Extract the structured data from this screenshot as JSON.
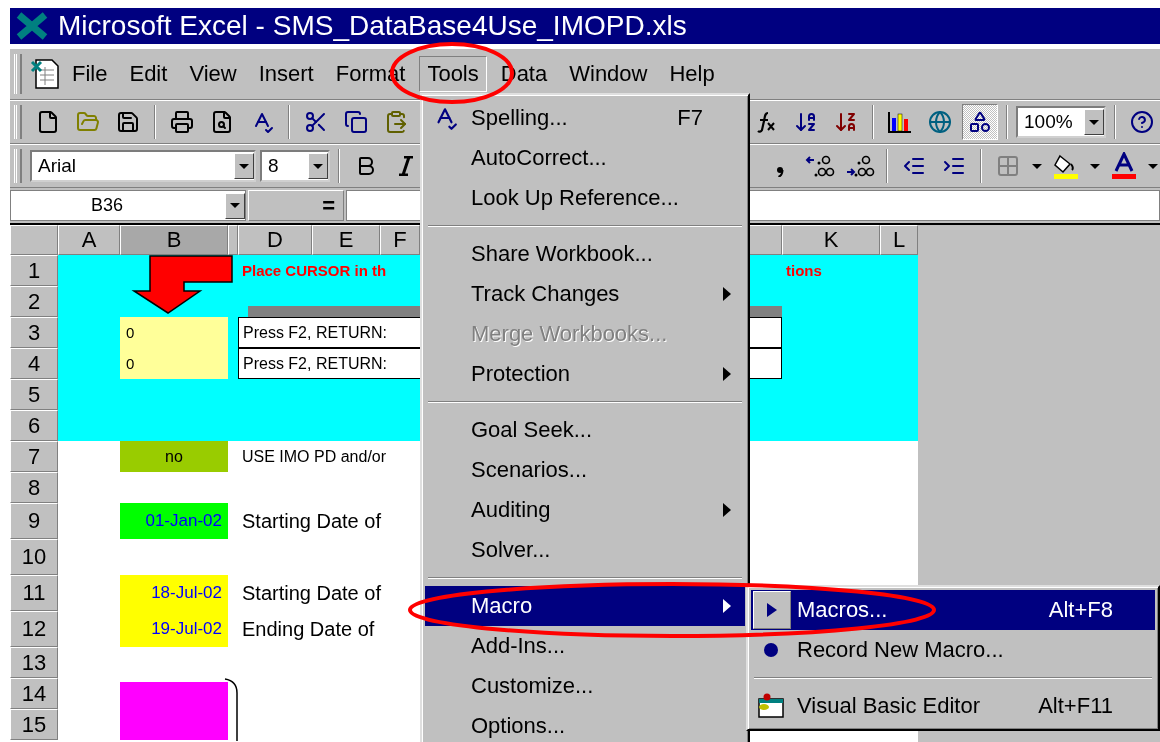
{
  "window": {
    "title": "Microsoft Excel - SMS_DataBase4Use_IMOPD.xls"
  },
  "menu_bar": [
    {
      "label": "File",
      "selected": false
    },
    {
      "label": "Edit",
      "selected": false
    },
    {
      "label": "View",
      "selected": false
    },
    {
      "label": "Insert",
      "selected": false
    },
    {
      "label": "Format",
      "selected": false
    },
    {
      "label": "Tools",
      "selected": true
    },
    {
      "label": "Data",
      "selected": false
    },
    {
      "label": "Window",
      "selected": false
    },
    {
      "label": "Help",
      "selected": false
    }
  ],
  "standard_toolbar": {
    "left": [
      {
        "kind": "new",
        "pressed": false
      },
      {
        "kind": "open",
        "pressed": false
      },
      {
        "kind": "save",
        "pressed": false
      },
      {
        "kind": "separator"
      },
      {
        "kind": "print",
        "pressed": false
      },
      {
        "kind": "preview",
        "pressed": false
      },
      {
        "kind": "spelling",
        "pressed": false
      },
      {
        "kind": "separator"
      },
      {
        "kind": "cut",
        "pressed": false
      },
      {
        "kind": "copy",
        "pressed": false
      },
      {
        "kind": "paste",
        "pressed": false
      }
    ],
    "right": [
      {
        "kind": "function",
        "pressed": false
      },
      {
        "kind": "sort-ascending",
        "pressed": false
      },
      {
        "kind": "sort-descending",
        "pressed": false
      },
      {
        "kind": "separator"
      },
      {
        "kind": "chart",
        "pressed": false
      },
      {
        "kind": "map",
        "pressed": false
      },
      {
        "kind": "drawing",
        "pressed": true
      },
      {
        "kind": "separator"
      },
      {
        "kind": "combo",
        "value": "100%"
      },
      {
        "kind": "separator"
      },
      {
        "kind": "help",
        "pressed": false
      }
    ]
  },
  "formatting_toolbar": {
    "left": [
      {
        "kind": "font",
        "value": "Arial"
      },
      {
        "kind": "size",
        "value": "8"
      },
      {
        "kind": "separator"
      },
      {
        "kind": "bold",
        "pressed": false
      },
      {
        "kind": "italic",
        "pressed": false
      }
    ],
    "right": [
      {
        "kind": "comma",
        "pressed": false
      },
      {
        "kind": "increase-decimal",
        "pressed": false
      },
      {
        "kind": "decrease-decimal",
        "pressed": false
      },
      {
        "kind": "separator"
      },
      {
        "kind": "outdent",
        "pressed": false
      },
      {
        "kind": "indent",
        "pressed": false
      },
      {
        "kind": "separator"
      },
      {
        "kind": "borders",
        "pressed": false
      },
      {
        "kind": "dropdown"
      },
      {
        "kind": "fill-color",
        "pressed": false
      },
      {
        "kind": "dropdown"
      },
      {
        "kind": "font-color",
        "pressed": false
      },
      {
        "kind": "dropdown"
      }
    ]
  },
  "formula_bar": {
    "name_box": "B36",
    "equals": "="
  },
  "columns": [
    {
      "label": "A",
      "selected": false
    },
    {
      "label": "B",
      "selected": true
    },
    {
      "selected": false
    },
    {
      "label": "D",
      "selected": false
    },
    {
      "label": "E",
      "selected": false
    },
    {
      "label": "F",
      "selected": false
    },
    {
      "label": "K",
      "selected": false
    },
    {
      "label": "L",
      "selected": false
    }
  ],
  "rows": [
    {
      "number": "1",
      "kind": "banner",
      "tall": false,
      "b": {
        "kind": "arrow"
      },
      "d": {
        "kind": "alert",
        "text": "Place CURSOR in th"
      },
      "k": {
        "kind": "alert",
        "text": "tions"
      }
    },
    {
      "number": "2",
      "kind": "banner",
      "tall": false,
      "d": {
        "kind": "bar"
      }
    },
    {
      "number": "3",
      "kind": "banner",
      "tall": false,
      "b": {
        "kind": "number",
        "text": "0",
        "color": "#ffff99"
      },
      "d": {
        "kind": "note",
        "text": "Press F2, RETURN:"
      }
    },
    {
      "number": "4",
      "kind": "banner",
      "tall": false,
      "b": {
        "kind": "number",
        "text": "0",
        "color": "#ffff99"
      },
      "d": {
        "kind": "note",
        "text": "Press F2, RETURN:"
      }
    },
    {
      "number": "5",
      "kind": "banner",
      "tall": false
    },
    {
      "number": "6",
      "kind": "banner",
      "tall": false
    },
    {
      "number": "7",
      "kind": "plain",
      "tall": false,
      "b": {
        "kind": "flag",
        "text": "no",
        "color": "#99cc00"
      },
      "d": {
        "kind": "label",
        "text": "USE IMO PD and/or"
      }
    },
    {
      "number": "8",
      "kind": "plain",
      "tall": false
    },
    {
      "number": "9",
      "kind": "plain",
      "tall": true,
      "b": {
        "kind": "date",
        "text": "01-Jan-02",
        "color": "#00ff00"
      },
      "d": {
        "kind": "heading",
        "text": "Starting Date of"
      }
    },
    {
      "number": "10",
      "kind": "plain",
      "tall": true
    },
    {
      "number": "11",
      "kind": "plain",
      "tall": true,
      "b": {
        "kind": "date",
        "text": "18-Jul-02",
        "color": "#ffff00"
      },
      "d": {
        "kind": "heading",
        "text": "Starting Date of"
      }
    },
    {
      "number": "12",
      "kind": "plain",
      "tall": true,
      "b": {
        "kind": "date",
        "text": "19-Jul-02",
        "color": "#ffff00"
      },
      "d": {
        "kind": "heading",
        "text": "Ending Date of"
      }
    },
    {
      "number": "13",
      "kind": "plain",
      "tall": false
    },
    {
      "number": "14",
      "kind": "plain",
      "tall": false,
      "b": {
        "kind": "block",
        "color": "#ff00ff"
      },
      "c": {
        "kind": "brace"
      }
    },
    {
      "number": "15",
      "kind": "plain",
      "tall": false,
      "b": {
        "kind": "block",
        "color": "#ff00ff"
      }
    }
  ],
  "tools_menu": [
    {
      "kind": "item",
      "label": "Spelling...",
      "shortcut": "F7",
      "submenu": false,
      "disabled": false,
      "selected": false
    },
    {
      "kind": "item",
      "label": "AutoCorrect...",
      "submenu": false,
      "disabled": false,
      "selected": false
    },
    {
      "kind": "item",
      "label": "Look Up Reference...",
      "submenu": false,
      "disabled": false,
      "selected": false
    },
    {
      "kind": "separator"
    },
    {
      "kind": "item",
      "label": "Share Workbook...",
      "submenu": false,
      "disabled": false,
      "selected": false
    },
    {
      "kind": "item",
      "label": "Track Changes",
      "submenu": true,
      "disabled": false,
      "selected": false
    },
    {
      "kind": "item",
      "label": "Merge Workbooks...",
      "submenu": false,
      "disabled": true,
      "selected": false
    },
    {
      "kind": "item",
      "label": "Protection",
      "submenu": true,
      "disabled": false,
      "selected": false
    },
    {
      "kind": "separator"
    },
    {
      "kind": "item",
      "label": "Goal Seek...",
      "submenu": false,
      "disabled": false,
      "selected": false
    },
    {
      "kind": "item",
      "label": "Scenarios...",
      "submenu": false,
      "disabled": false,
      "selected": false
    },
    {
      "kind": "item",
      "label": "Auditing",
      "submenu": true,
      "disabled": false,
      "selected": false
    },
    {
      "kind": "item",
      "label": "Solver...",
      "submenu": false,
      "disabled": false,
      "selected": false
    },
    {
      "kind": "separator"
    },
    {
      "kind": "item",
      "label": "Macro",
      "submenu": true,
      "disabled": false,
      "selected": true
    },
    {
      "kind": "item",
      "label": "Add-Ins...",
      "submenu": false,
      "disabled": false,
      "selected": false
    },
    {
      "kind": "item",
      "label": "Customize...",
      "submenu": false,
      "disabled": false,
      "selected": false
    },
    {
      "kind": "item",
      "label": "Options...",
      "submenu": false,
      "disabled": false,
      "selected": false
    }
  ],
  "macro_submenu": [
    {
      "kind": "item",
      "label": "Macros...",
      "shortcut": "Alt+F8",
      "selected": true
    },
    {
      "kind": "item",
      "label": "Record New Macro...",
      "selected": false
    },
    {
      "kind": "separator"
    },
    {
      "kind": "item",
      "label": "Visual Basic Editor",
      "shortcut": "Alt+F11",
      "selected": false
    }
  ]
}
